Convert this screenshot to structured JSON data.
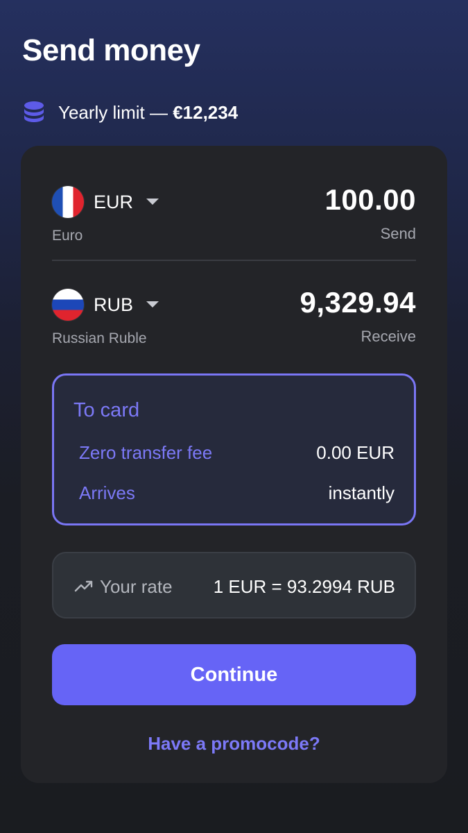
{
  "header": {
    "title": "Send money",
    "limit_label": "Yearly limit — ",
    "limit_value": "€12,234",
    "limit_icon": "coins-stack-icon"
  },
  "send": {
    "currency_code": "EUR",
    "currency_name": "Euro",
    "amount": "100.00",
    "amount_label": "Send",
    "flag": "france-flag-icon"
  },
  "receive": {
    "currency_code": "RUB",
    "currency_name": "Russian Ruble",
    "amount": "9,329.94",
    "amount_label": "Receive",
    "flag": "russia-flag-icon"
  },
  "delivery": {
    "title": "To card",
    "fee_label": "Zero transfer fee",
    "fee_value": "0.00 EUR",
    "arrival_label": "Arrives",
    "arrival_value": "instantly"
  },
  "rate": {
    "label": "Your rate",
    "value": "1 EUR = 93.2994 RUB",
    "icon": "trending-up-icon"
  },
  "actions": {
    "continue_label": "Continue",
    "promo_label": "Have a promocode?"
  },
  "colors": {
    "accent": "#6664f6",
    "accent_text": "#7c79f7",
    "card_bg": "#232428",
    "muted_text": "#a6a8b0"
  }
}
